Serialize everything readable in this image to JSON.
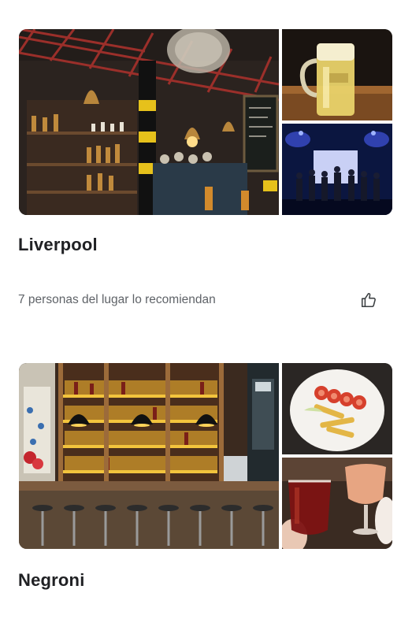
{
  "places": [
    {
      "name": "Liverpool",
      "recommendation": "7 personas del lugar lo recomiendan",
      "photos": [
        {
          "label": "Interior del bar con campanas y botellas"
        },
        {
          "label": "Jarra de cerveza"
        },
        {
          "label": "Banda tocando en el escenario"
        }
      ]
    },
    {
      "name": "Negroni",
      "photos": [
        {
          "label": "Barra con estantes de botellas iluminados"
        },
        {
          "label": "Plato con papas fritas y tomates"
        },
        {
          "label": "Dos copas de tragos"
        }
      ]
    }
  ],
  "icons": {
    "recommend": "thumbs-up-icon"
  },
  "colors": {
    "title": "#202124",
    "secondary": "#5f6368",
    "background": "#ffffff"
  }
}
